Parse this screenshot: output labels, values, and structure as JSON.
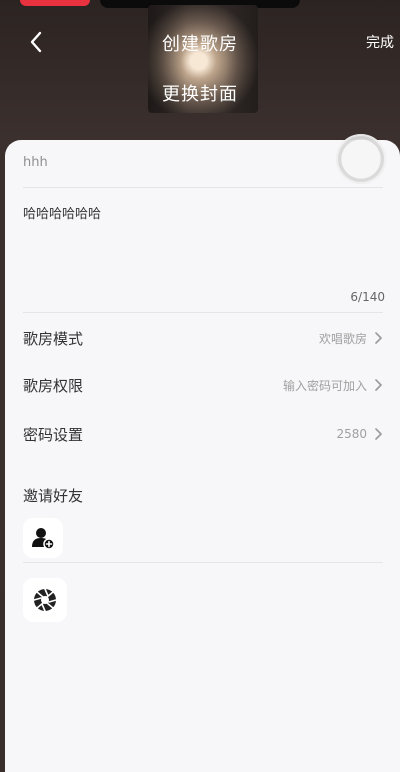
{
  "header": {
    "title": "创建歌房",
    "done_label": "完成",
    "change_cover_label": "更换封面"
  },
  "form": {
    "room_name": "hhh",
    "description": "哈哈哈哈哈哈",
    "char_counter": "6/140"
  },
  "settings": [
    {
      "label": "歌房模式",
      "value": "欢唱歌房"
    },
    {
      "label": "歌房权限",
      "value": "输入密码可加入"
    },
    {
      "label": "密码设置",
      "value": "2580"
    }
  ],
  "invite": {
    "label": "邀请好友"
  },
  "icons": {
    "back": "chevron-left-icon",
    "add_friend": "add-user-icon",
    "shutter": "camera-shutter-icon",
    "floating": "floating-ball-icon"
  }
}
